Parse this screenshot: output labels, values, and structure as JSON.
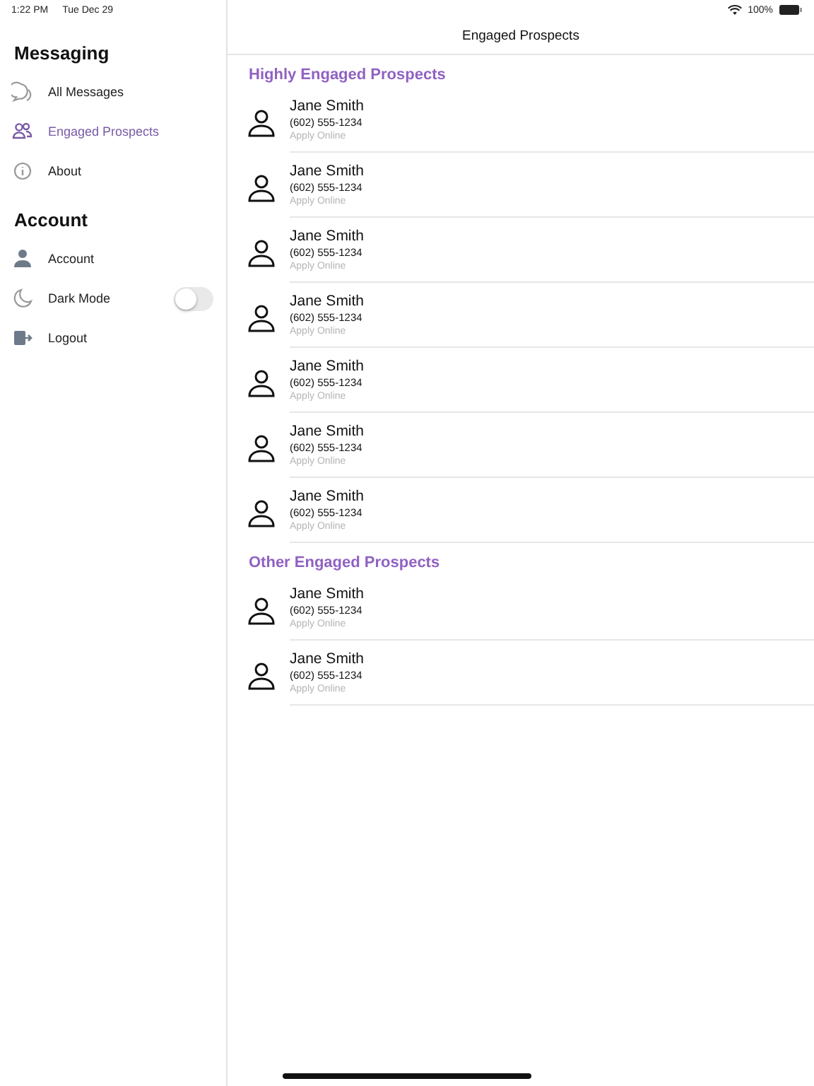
{
  "status_bar": {
    "time": "1:22 PM",
    "date": "Tue Dec 29",
    "battery": "100%"
  },
  "sidebar": {
    "sections": [
      {
        "title": "Messaging",
        "items": [
          {
            "kind": "link",
            "label": "All Messages",
            "selected": false
          },
          {
            "kind": "link",
            "label": "Engaged Prospects",
            "selected": true
          },
          {
            "kind": "link",
            "label": "About",
            "selected": false
          }
        ]
      },
      {
        "title": "Account",
        "items": [
          {
            "kind": "link",
            "label": "Account",
            "selected": false
          },
          {
            "kind": "toggle",
            "label": "Dark Mode",
            "on": false
          },
          {
            "kind": "link",
            "label": "Logout",
            "selected": false
          }
        ]
      }
    ]
  },
  "main": {
    "title": "Engaged Prospects",
    "groups": [
      {
        "title": "Highly Engaged Prospects",
        "rows": [
          {
            "name": "Jane Smith",
            "phone": "(602) 555-1234",
            "source": "Apply Online"
          },
          {
            "name": "Jane Smith",
            "phone": "(602) 555-1234",
            "source": "Apply Online"
          },
          {
            "name": "Jane Smith",
            "phone": "(602) 555-1234",
            "source": "Apply Online"
          },
          {
            "name": "Jane Smith",
            "phone": "(602) 555-1234",
            "source": "Apply Online"
          },
          {
            "name": "Jane Smith",
            "phone": "(602) 555-1234",
            "source": "Apply Online"
          },
          {
            "name": "Jane Smith",
            "phone": "(602) 555-1234",
            "source": "Apply Online"
          },
          {
            "name": "Jane Smith",
            "phone": "(602) 555-1234",
            "source": "Apply Online"
          }
        ]
      },
      {
        "title": "Other Engaged Prospects",
        "rows": [
          {
            "name": "Jane Smith",
            "phone": "(602) 555-1234",
            "source": "Apply Online"
          },
          {
            "name": "Jane Smith",
            "phone": "(602) 555-1234",
            "source": "Apply Online"
          }
        ]
      }
    ]
  }
}
